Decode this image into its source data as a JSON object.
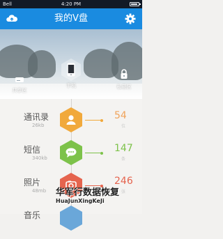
{
  "status_bar": {
    "carrier": "Bell",
    "time": "4:20 PM"
  },
  "navbar": {
    "title": "我的V盘",
    "left_icon": "cloud-icon",
    "right_icon": "gear-icon"
  },
  "destinations": [
    {
      "label": "共享区",
      "icon": "hard-drive-icon"
    },
    {
      "label": "手机",
      "icon": "phone-icon",
      "active": true
    },
    {
      "label": "私密区",
      "icon": "lock-icon"
    }
  ],
  "items": [
    {
      "name": "通讯录",
      "size": "26kb",
      "count": "54",
      "unit": "位",
      "icon": "contact-icon",
      "color": "#f1a93c"
    },
    {
      "name": "短信",
      "size": "340kb",
      "count": "147",
      "unit": "条",
      "icon": "message-icon",
      "color": "#7dc24a"
    },
    {
      "name": "照片",
      "size": "48mb",
      "count": "246",
      "unit": "张",
      "icon": "photo-icon",
      "color": "#e5644e"
    },
    {
      "name": "音乐",
      "size": "",
      "count": "",
      "unit": "",
      "icon": "music-icon",
      "color": "#6aa7d9"
    }
  ],
  "watermark": {
    "line1": "华军行数据恢复",
    "line2": "HuaJunXingKeJi"
  }
}
